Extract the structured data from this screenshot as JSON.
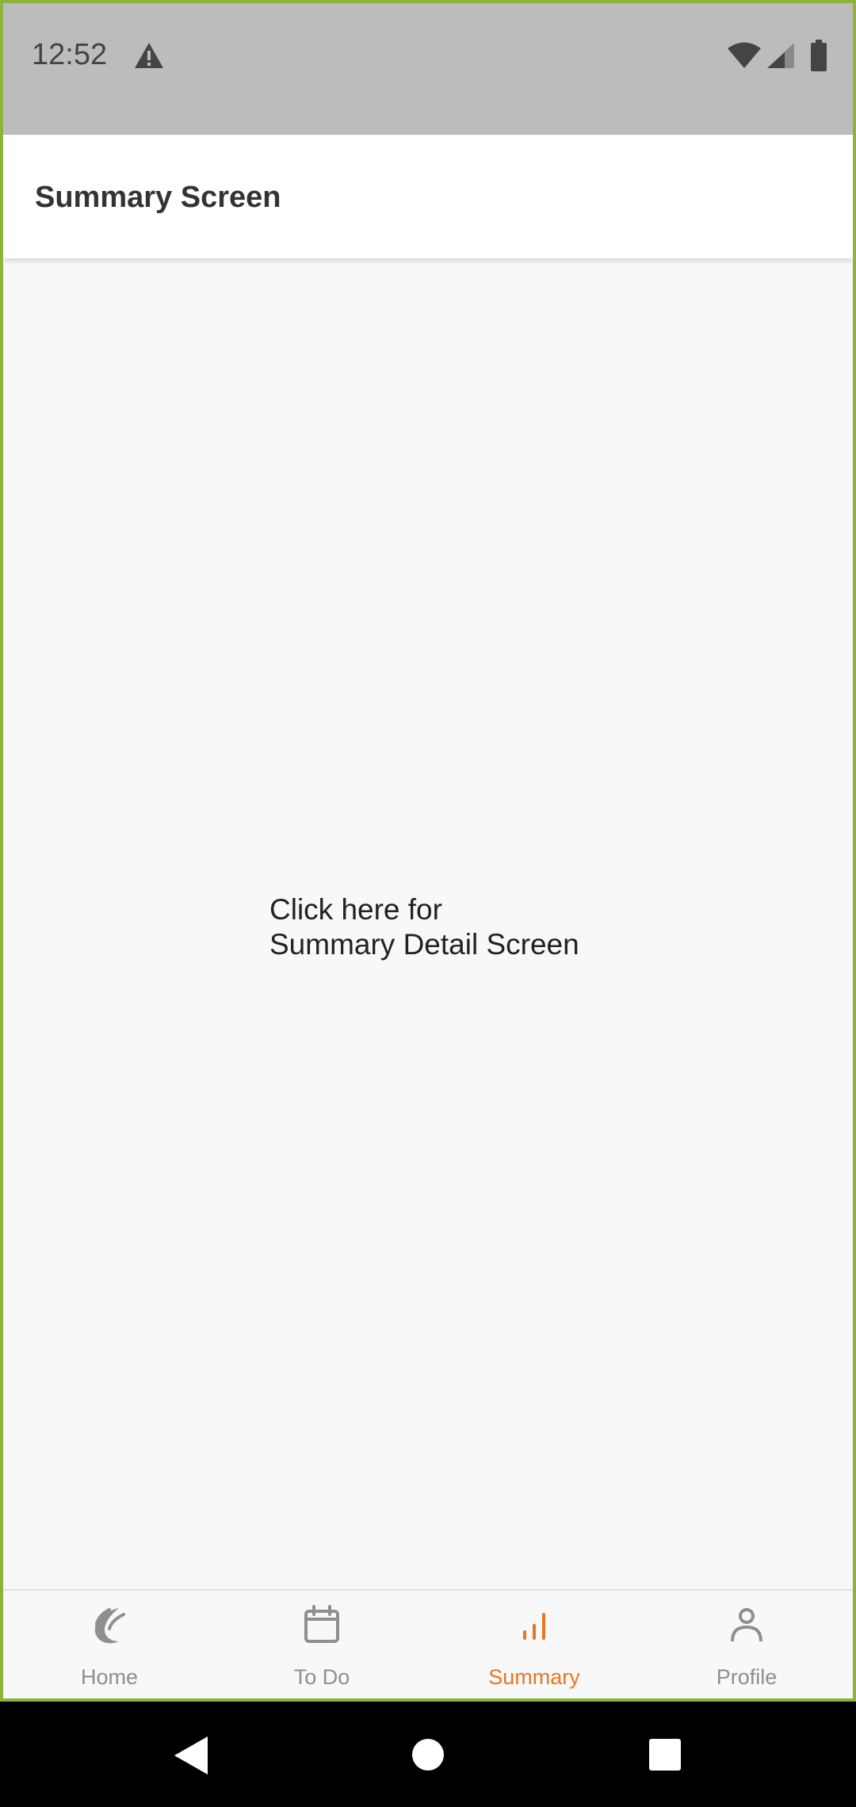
{
  "status_bar": {
    "time": "12:52",
    "icons": [
      "warning-icon",
      "wifi-icon",
      "signal-icon",
      "battery-icon"
    ]
  },
  "app_bar": {
    "title": "Summary Screen"
  },
  "content": {
    "link_line1": "Click here for",
    "link_line2": "Summary Detail Screen"
  },
  "bottom_nav": {
    "items": [
      {
        "label": "Home",
        "icon": "home-logo-icon",
        "active": false
      },
      {
        "label": "To Do",
        "icon": "calendar-icon",
        "active": false
      },
      {
        "label": "Summary",
        "icon": "bar-chart-icon",
        "active": true
      },
      {
        "label": "Profile",
        "icon": "person-icon",
        "active": false
      }
    ]
  },
  "system_nav": {
    "icons": [
      "back-icon",
      "home-icon",
      "recents-icon"
    ]
  },
  "colors": {
    "accent": "#e87722",
    "inactive": "#8f8f8f",
    "status_bar": "#bcbcbc",
    "frame_border": "#8db33a"
  }
}
